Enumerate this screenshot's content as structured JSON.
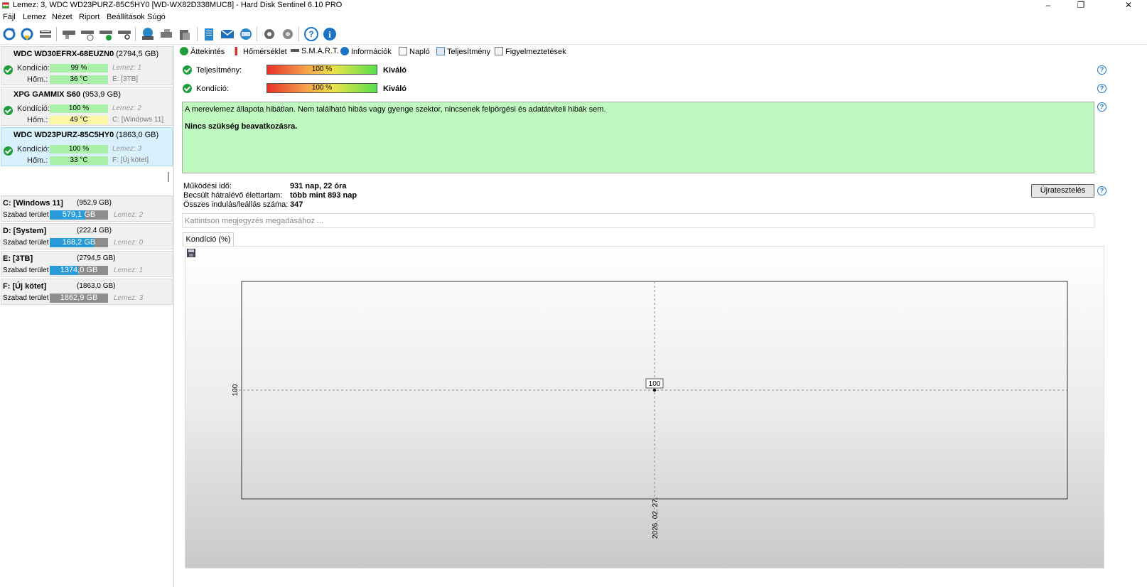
{
  "window": {
    "title": "Lemez: 3, WDC WD23PURZ-85C5HY0 [WD-WX82D338MUC8]  -  Hard Disk Sentinel 6.10 PRO",
    "minimize": "–",
    "maximize": "❐",
    "close": "✕"
  },
  "menu": [
    "Fájl",
    "Lemez",
    "Nézet",
    "Riport",
    "Beállítások",
    "Súgó"
  ],
  "toolbar_icons": [
    "refresh-icon",
    "refresh-all-icon",
    "disk-settings-icon",
    "disk-gray-icon",
    "disk-clock-icon",
    "disk-check-icon",
    "disk-search-icon",
    "disk-network-icon",
    "disk-tools-icon",
    "disk-backup-icon",
    "report-notepad-icon",
    "mail-report-icon",
    "web-report-icon",
    "settings-gear-icon",
    "tools-gear-icon",
    "help-icon",
    "info-icon"
  ],
  "disks": [
    {
      "name": "WDC WD30EFRX-68EUZN0",
      "size": "(2794,5 GB)",
      "cond_label": "Kondíció:",
      "cond": "99 %",
      "disk_no": "Lemez: 1",
      "temp_label": "Hőm.:",
      "temp": "36 °C",
      "volume": "E: [3TB]",
      "temp_color": "green"
    },
    {
      "name": "XPG GAMMIX S60",
      "size": "(953,9 GB)",
      "cond_label": "Kondíció:",
      "cond": "100 %",
      "disk_no": "Lemez: 2",
      "temp_label": "Hőm.:",
      "temp": "49 °C",
      "volume": "C: [Windows 11]",
      "temp_color": "yellow"
    },
    {
      "name": "WDC WD23PURZ-85C5HY0",
      "size": "(1863,0 GB)",
      "cond_label": "Kondíció:",
      "cond": "100 %",
      "disk_no": "Lemez: 3",
      "temp_label": "Hőm.:",
      "temp": "33 °C",
      "volume": "F: [Új kötet]",
      "temp_color": "green"
    }
  ],
  "volumes": [
    {
      "name": "C: [Windows 11]",
      "size": "(952,9 GB)",
      "free_label": "Szabad terület",
      "free": "579,1 GB",
      "free_ratio": 0.608,
      "disk": "Lemez: 2"
    },
    {
      "name": "D: [System]",
      "size": "(222,4 GB)",
      "free_label": "Szabad terület",
      "free": "168,2 GB",
      "free_ratio": 0.756,
      "disk": "Lemez: 0"
    },
    {
      "name": "E: [3TB]",
      "size": "(2794,5 GB)",
      "free_label": "Szabad terület",
      "free": "1374,0 GB",
      "free_ratio": 0.492,
      "disk": "Lemez: 1"
    },
    {
      "name": "F: [Új kötet]",
      "size": "(1863,0 GB)",
      "free_label": "Szabad terület",
      "free": "1862,9 GB",
      "free_ratio": 0.0,
      "disk": "Lemez: 3"
    }
  ],
  "tabs": [
    "Áttekintés",
    "Hőmérséklet",
    "S.M.A.R.T.",
    "Információk",
    "Napló",
    "Teljesítmény",
    "Figyelmeztetések"
  ],
  "status": {
    "perf_label": "Teljesítmény:",
    "perf_value": "100 %",
    "perf_word": "Kiváló",
    "cond_label": "Kondíció:",
    "cond_value": "100 %",
    "cond_word": "Kiváló",
    "message": "A merevlemez állapota hibátlan. Nem található hibás vagy gyenge szektor, nincsenek felpörgési és adatátviteli hibák sem.",
    "message_bold": "Nincs szükség beavatkozásra."
  },
  "info": {
    "uptime_label": "Működési idő:",
    "uptime": "931 nap, 22 óra",
    "life_label": "Becsült hátralévő élettartam:",
    "life": "több mint 893 nap",
    "starts_label": "Összes indulás/leállás száma:",
    "starts": "347",
    "retest": "Újratesztelés",
    "note_placeholder": "Kattintson megjegyzés megadásához ..."
  },
  "graph_tab": "Kondíció  (%)",
  "chart_data": {
    "type": "line",
    "x": [
      "2026. 02. 27."
    ],
    "series": [
      {
        "values": [
          100
        ]
      }
    ],
    "data_labels": [
      "100"
    ],
    "ytick_labels": [
      "100"
    ],
    "xtick_labels": [
      "2026. 02. 27."
    ],
    "grid": true
  }
}
